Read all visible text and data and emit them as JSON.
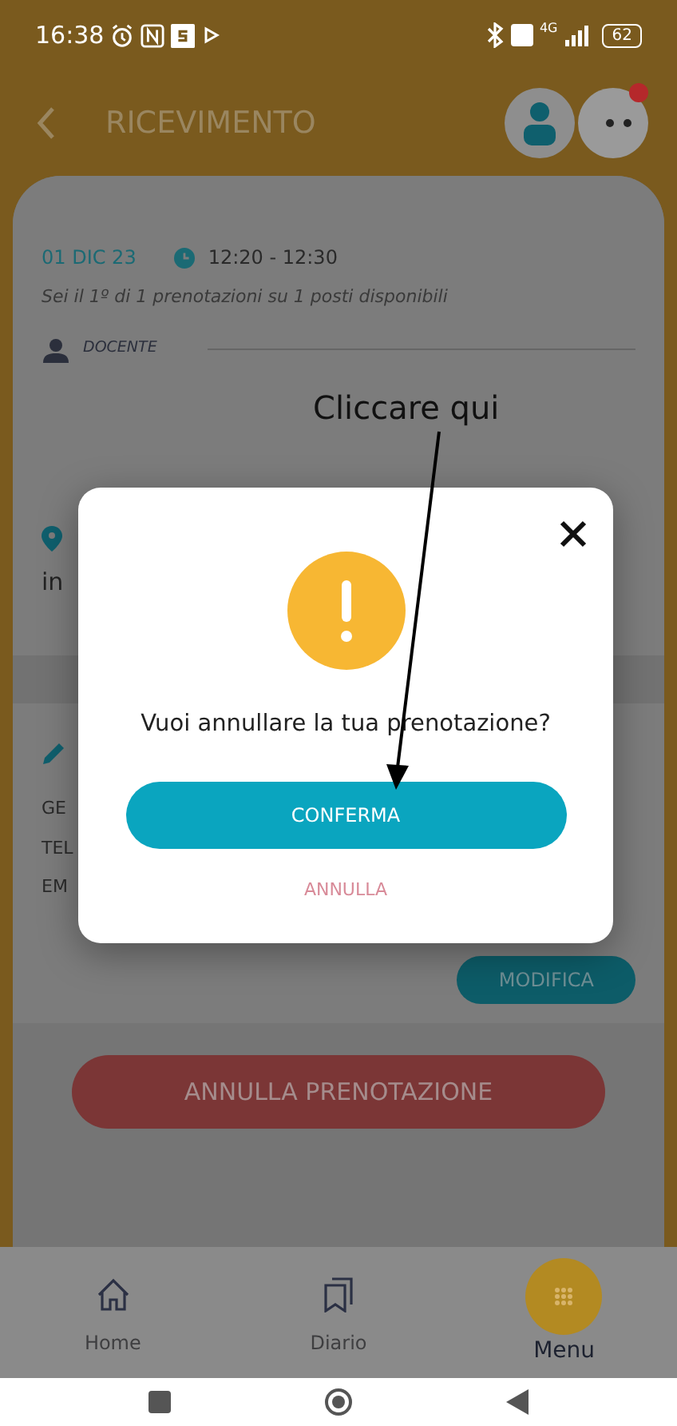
{
  "status_bar": {
    "time": "16:38",
    "network": "4G",
    "battery": "62"
  },
  "header": {
    "title": "RICEVIMENTO",
    "notification": true
  },
  "booking": {
    "date": "01 DIC 23",
    "time": "12:20 - 12:30",
    "position_note": "Sei il 1º di 1 prenotazioni su 1 posti disponibili",
    "role_label": "DOCENTE",
    "location_text": "in",
    "contact_labels": [
      "GE",
      "TEL",
      "EM"
    ],
    "edit_button": "MODIFICA"
  },
  "cancel_booking_button": "ANNULLA PRENOTAZIONE",
  "bottom_nav": [
    {
      "label": "Home",
      "selected": false
    },
    {
      "label": "Diario",
      "selected": false
    },
    {
      "label": "Menu",
      "selected": true
    }
  ],
  "dialog": {
    "message": "Vuoi annullare la tua prenotazione?",
    "confirm_button": "CONFERMA",
    "cancel_button": "ANNULLA"
  },
  "annotation": {
    "text": "Cliccare qui"
  }
}
